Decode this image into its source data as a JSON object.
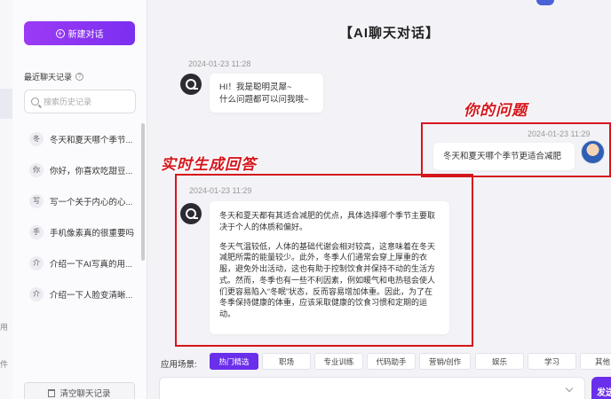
{
  "rail": {
    "glyphs": [
      "用",
      "件"
    ]
  },
  "sidebar": {
    "new_chat_label": "新建对话",
    "recent_title": "最近聊天记录",
    "search_placeholder": "搜索历史记录",
    "history": [
      {
        "avatar": "冬",
        "text": "冬天和夏天哪个季节..."
      },
      {
        "avatar": "你",
        "text": "你好，你喜欢吃甜豆..."
      },
      {
        "avatar": "写",
        "text": "写一个关于内心的心..."
      },
      {
        "avatar": "手",
        "text": "手机像素真的很重要吗"
      },
      {
        "avatar": "介",
        "text": "介绍一下AI写真的用..."
      },
      {
        "avatar": "介",
        "text": "介绍一下人脸变清晰..."
      }
    ],
    "clear_label": "清空聊天记录"
  },
  "main": {
    "title": "【AI聊天对话】",
    "messages": [
      {
        "role": "bot",
        "time": "2024-01-23 11:28",
        "lines": [
          "HI！我是聪明灵犀~",
          "什么问题都可以问我哦~"
        ]
      },
      {
        "role": "user",
        "time": "2024-01-23 11:29",
        "lines": [
          "冬天和夏天哪个季节更适合减肥"
        ]
      },
      {
        "role": "bot",
        "time": "2024-01-23 11:29",
        "paragraphs": [
          "冬天和夏天都有其适合减肥的优点，具体选择哪个季节主要取决于个人的体质和偏好。",
          "冬天气温较低，人体的基础代谢会相对较高，这意味着在冬天减肥所需的能量较少。此外，冬季人们通常会穿上厚重的衣服，避免外出活动，这也有助于控制饮食并保持不动的生活方式。然而，冬季也有一些不利因素，例如暖气和电热毯会使人们更容易陷入“冬眠”状态，反而容易增加体重。因此，为了在冬季保持健康的体重，应该采取健康的饮食习惯和定期的运动。"
        ]
      }
    ],
    "annotations": {
      "question": "你的问题",
      "answer": "实时生成回答"
    }
  },
  "scenes": {
    "label": "应用场景:",
    "tags": [
      "热门精选",
      "职场",
      "专业训练",
      "代码助手",
      "营销/创作",
      "娱乐",
      "学习",
      "其他"
    ],
    "active_index": 0
  },
  "input": {
    "placeholder": ""
  },
  "send_label": "发送",
  "colors": {
    "accent": "#6a2fea",
    "gradient_start": "#9b3bf5",
    "annotation_red": "#d4161c"
  }
}
